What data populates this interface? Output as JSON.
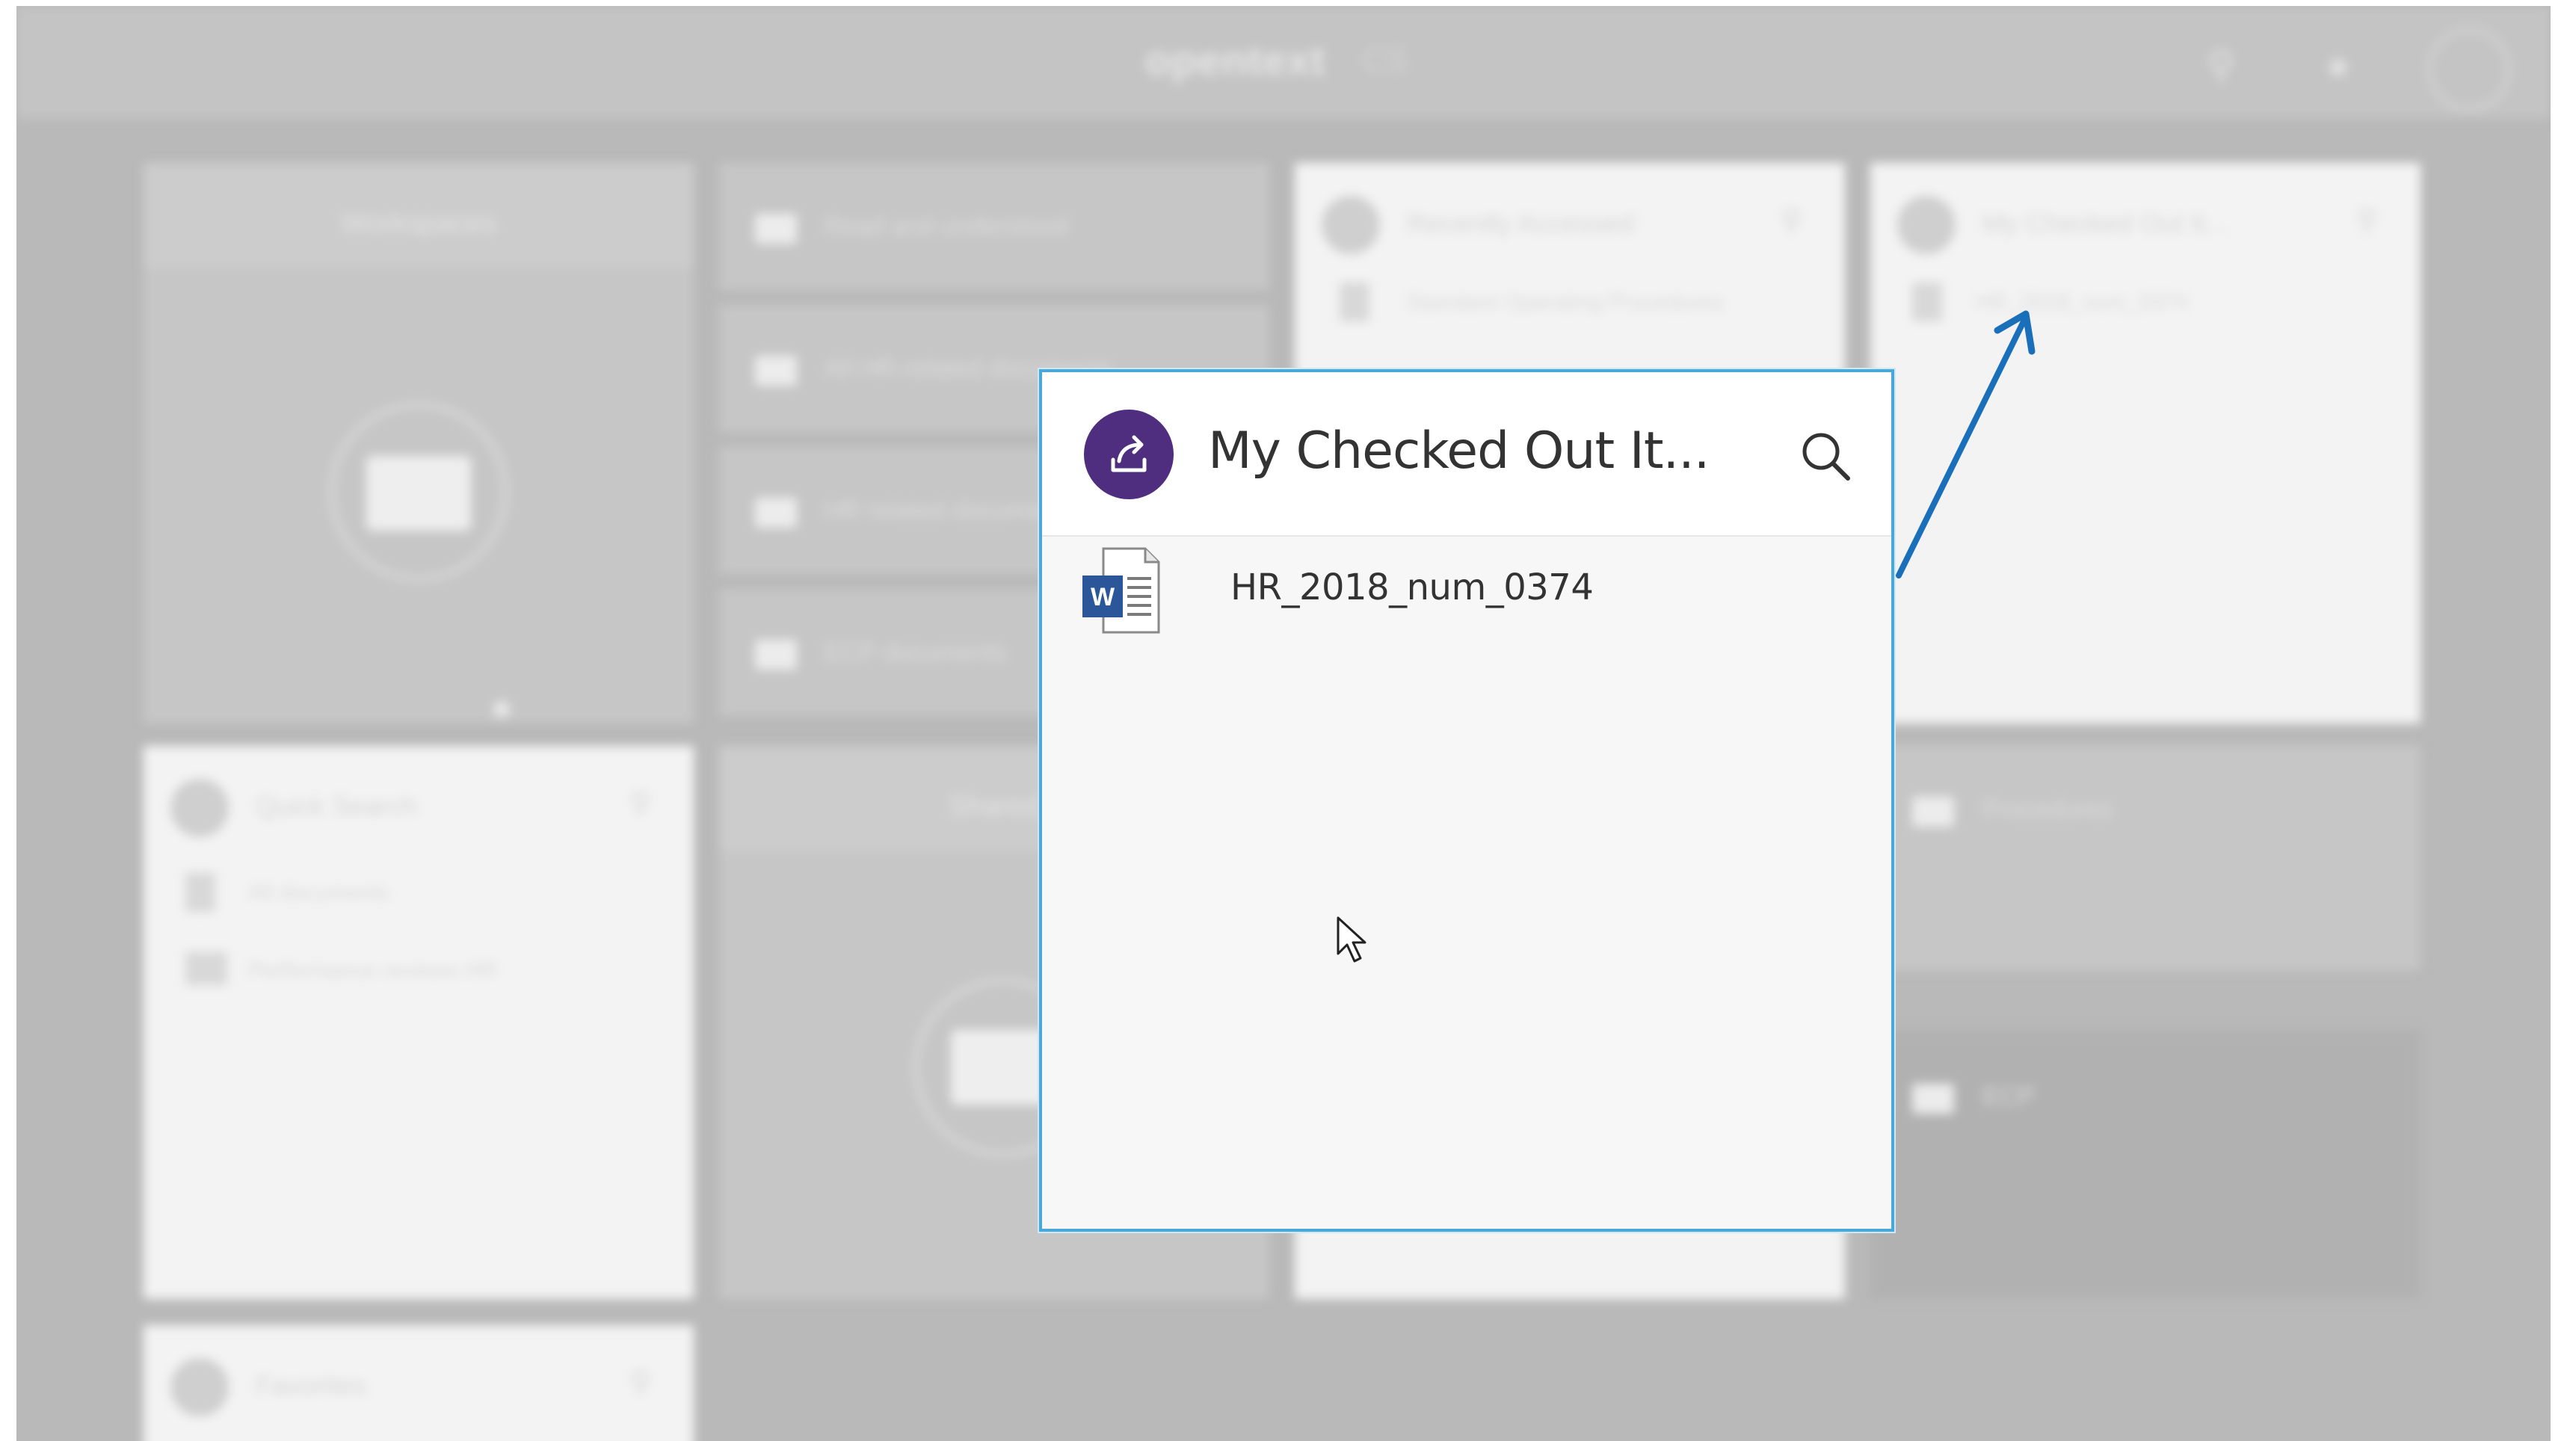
{
  "background": {
    "brand": "opentext",
    "brand_sub": "CS",
    "tiles": {
      "workspaces_title": "Workspaces",
      "folders": [
        "Read and understood",
        "All HR-related documents",
        "HR related documents",
        "ECP documents"
      ],
      "recently_accessed_title": "Recently Accessed",
      "recently_accessed_item": "Standard Operating Procedures",
      "checked_out_title": "My Checked Out It...",
      "checked_out_item": "HR_2018_num_0374",
      "quick_search_title": "Quick Search",
      "quick_search_items": [
        "All documents",
        "Performance reviews HR"
      ],
      "favorites_title": "Favorites",
      "shared_title": "Shared",
      "procedures_label": "Procedures",
      "ecp_label": "ECP"
    }
  },
  "widget": {
    "title": "My Checked Out It...",
    "avatar_icon": "checkout-share-icon",
    "search_icon": "search-icon",
    "items": [
      {
        "name": "HR_2018_num_0374",
        "icon": "word-document-icon"
      }
    ]
  },
  "colors": {
    "avatar_bg": "#4f2d7f",
    "widget_border": "#4aa8d8",
    "arrow": "#1a6fba",
    "word_blue": "#2b579a"
  }
}
